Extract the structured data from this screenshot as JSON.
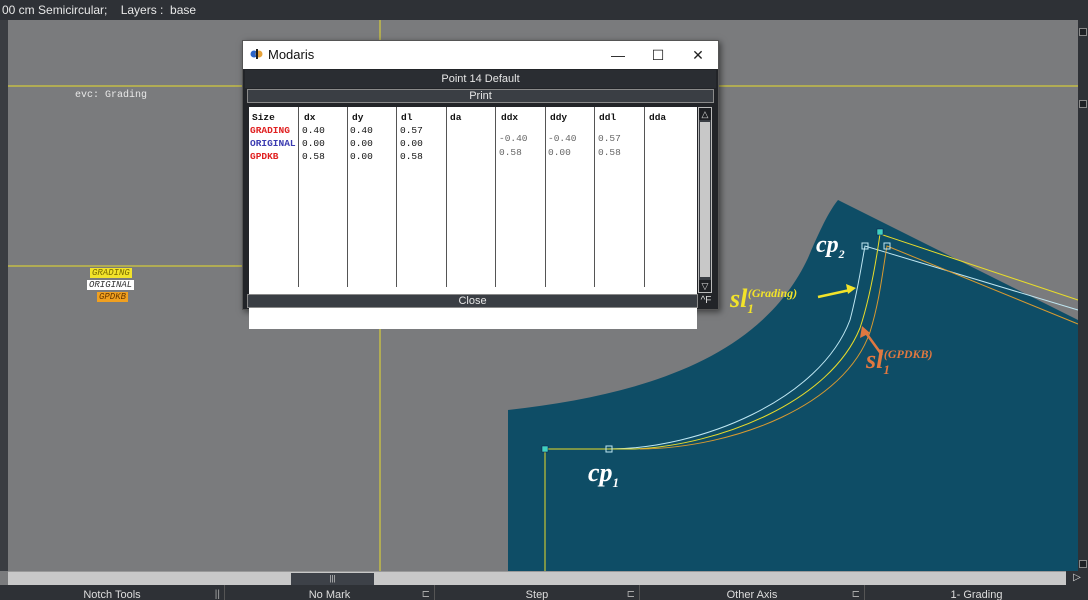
{
  "topbar": {
    "text": "00 cm Semicircular;    Layers :  base"
  },
  "canvas": {
    "bg_color": "#7a7b7d",
    "piece_color": "#0e4d66",
    "evc_label": "evc: Grading",
    "legend": [
      {
        "label": "GRADING",
        "bg": "#f2e32a",
        "fg": "#7a6b00"
      },
      {
        "label": "ORIGINAL",
        "bg": "#ffffff",
        "fg": "#333333"
      },
      {
        "label": "GPDKB",
        "bg": "#f0a020",
        "fg": "#6a3a00"
      }
    ]
  },
  "dialog": {
    "title": "Modaris",
    "window_buttons": {
      "minimize": "—",
      "maximize": "☐",
      "close": "✕"
    },
    "header": "Point 14 Default",
    "print_label": "Print",
    "close_label": "Close",
    "close_shortcut": "^F",
    "scroll_up": "△",
    "scroll_down": "▽",
    "table": {
      "columns": [
        "Size",
        "dx",
        "dy",
        "dl",
        "da",
        "ddx",
        "ddy",
        "ddl",
        "dda"
      ],
      "rows": [
        {
          "size": "GRADING",
          "size_color": "#e02020",
          "dx": "0.40",
          "dy": "0.40",
          "dl": "0.57",
          "da": "",
          "ddx": "",
          "ddy": "",
          "ddl": "",
          "dda": ""
        },
        {
          "size": "ORIGINAL",
          "size_color": "#3a3ab0",
          "dx": "0.00",
          "dy": "0.00",
          "dl": "0.00",
          "da": "",
          "ddx": "-0.40",
          "ddy": "-0.40",
          "ddl": "0.57",
          "dda": ""
        },
        {
          "size": "GPDKB",
          "size_color": "#e02020",
          "dx": "0.58",
          "dy": "0.00",
          "dl": "0.58",
          "da": "",
          "ddx": "0.58",
          "ddy": "0.00",
          "ddl": "0.58",
          "dda": ""
        }
      ]
    }
  },
  "annotations": {
    "cp1": {
      "base": "cp",
      "sub": "1",
      "color": "#ffffff"
    },
    "cp2": {
      "base": "cp",
      "sub": "2",
      "color": "#ffffff"
    },
    "sl_grading": {
      "base": "sl",
      "sub": "1",
      "sup": "(Grading)",
      "color": "#f2e32a"
    },
    "sl_gpdkb": {
      "base": "sl",
      "sub": "1",
      "sup": "(GPDKB)",
      "color": "#e07840"
    }
  },
  "hscroll": {
    "thumb_label": "|||",
    "end_arrow": "▷"
  },
  "bottombar": [
    {
      "label": "Notch Tools",
      "sym": "||"
    },
    {
      "label": "No Mark",
      "sym": "⊏"
    },
    {
      "label": "Step",
      "sym": "⊏"
    },
    {
      "label": "Other Axis",
      "sym": "⊏"
    },
    {
      "label": "1- Grading",
      "sym": ""
    }
  ]
}
